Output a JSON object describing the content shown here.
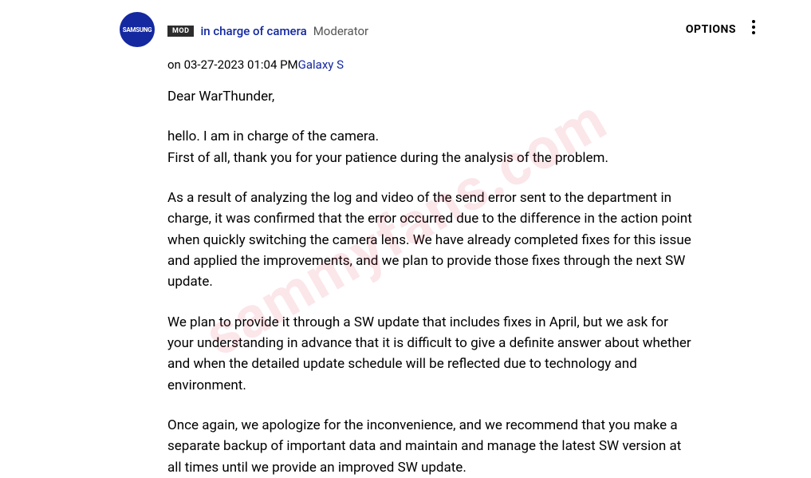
{
  "avatar": {
    "label": "SAMSUNG"
  },
  "header": {
    "mod_badge": "MOD",
    "username": "in charge of camera",
    "role": "Moderator"
  },
  "options": {
    "label": "OPTIONS"
  },
  "meta": {
    "on": "on ",
    "timestamp": "03-27-2023 01:04 PM",
    "device": "Galaxy S"
  },
  "body": {
    "p1": "Dear WarThunder,",
    "p2a": "hello. I am in charge of the camera.",
    "p2b": "First of all, thank you for your patience during the analysis of the problem.",
    "p3": "As a result of analyzing the log and video of the send error sent to the department in charge, it was confirmed that the error occurred due to the difference in the action point when quickly switching the camera lens. We have already completed fixes for this issue and applied the improvements, and we plan to provide those fixes through the next SW update.",
    "p4": "We plan to provide it through a SW update that includes fixes in April, but we ask for your understanding in advance that it is difficult to give a definite answer about whether and when the detailed update schedule will be reflected due to technology and environment.",
    "p5": "Once again, we apologize for the inconvenience, and we recommend that you make a separate backup of important data and maintain and manage the latest SW version at all times until we provide an improved SW update."
  },
  "watermark": "sammyfans.com"
}
